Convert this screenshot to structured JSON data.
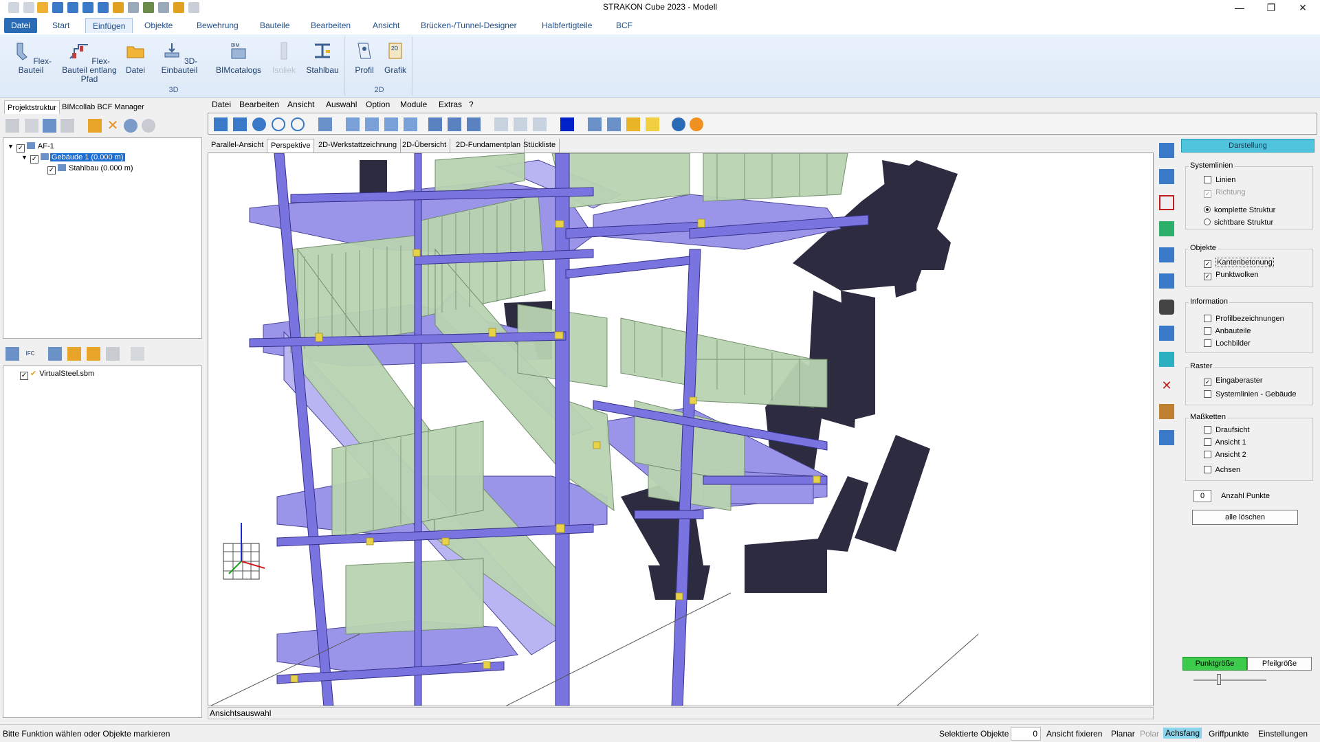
{
  "window": {
    "title": "STRAKON Cube 2023 - Modell",
    "controls": {
      "minimize": "—",
      "maximize": "❐",
      "close": "✕"
    }
  },
  "ribbon": {
    "tabs": [
      "Datei",
      "Start",
      "Einfügen",
      "Objekte",
      "Bewehrung",
      "Bauteile",
      "Bearbeiten",
      "Ansicht",
      "Brücken-/Tunnel-Designer",
      "Halbfertigteile",
      "BCF"
    ],
    "active_tab": "Einfügen",
    "groups": [
      {
        "label": "3D",
        "buttons": [
          {
            "label": "Flex-Bauteil",
            "icon": "flex-part-icon"
          },
          {
            "label": "Flex-Bauteil entlang Pfad",
            "icon": "flex-path-icon"
          },
          {
            "label": "Datei",
            "icon": "folder-icon"
          },
          {
            "label": "3D-Einbauteil",
            "icon": "insert-part-icon"
          },
          {
            "label": "BIMcatalogs",
            "icon": "bim-catalog-icon",
            "badge": "BIM"
          },
          {
            "label": "Isoliek",
            "icon": "isolation-icon",
            "disabled": true
          },
          {
            "label": "Stahlbau",
            "icon": "steel-icon"
          }
        ]
      },
      {
        "label": "2D",
        "buttons": [
          {
            "label": "Profil",
            "icon": "profile-icon"
          },
          {
            "label": "Grafik",
            "icon": "graphic-icon",
            "badge": "2D"
          }
        ]
      }
    ]
  },
  "left_panel": {
    "tabs": [
      "Projektstruktur",
      "BIMcollab BCF Manager"
    ],
    "active_tab": "Projektstruktur",
    "tree": [
      {
        "label": "AF-1",
        "checked": true,
        "level": 0
      },
      {
        "label": "Gebäude 1 (0.000 m)",
        "checked": true,
        "level": 1,
        "selected": true
      },
      {
        "label": "Stahlbau (0.000 m)",
        "checked": true,
        "level": 2
      }
    ],
    "lower_toolbar_badge": "IFC",
    "lower_tree": [
      {
        "label": "VirtualSteel.sbm",
        "checked": true
      }
    ]
  },
  "menu": [
    "Datei",
    "Bearbeiten",
    "Ansicht",
    "Auswahl",
    "Option",
    "Module",
    "Extras",
    "?"
  ],
  "view_tabs": [
    "Parallel-Ansicht",
    "Perspektive",
    "2D-Werkstattzeichnung",
    "2D-Übersicht",
    "2D-Fundamentplan",
    "Stückliste"
  ],
  "active_view_tab": "Perspektive",
  "view_status": "Ansichtsauswahl",
  "display_panel": {
    "header": "Darstellung",
    "groups": [
      {
        "title": "Systemlinien",
        "items": [
          {
            "type": "checkbox",
            "label": "Linien",
            "checked": false
          },
          {
            "type": "checkbox",
            "label": "Richtung",
            "checked": true,
            "disabled": true
          },
          {
            "type": "radio",
            "label": "komplette Struktur",
            "checked": true
          },
          {
            "type": "radio",
            "label": "sichtbare Struktur",
            "checked": false
          }
        ]
      },
      {
        "title": "Objekte",
        "items": [
          {
            "type": "checkbox",
            "label": "Kantenbetonung",
            "checked": true
          },
          {
            "type": "checkbox",
            "label": "Punktwolken",
            "checked": true
          }
        ]
      },
      {
        "title": "Information",
        "items": [
          {
            "type": "checkbox",
            "label": "Profilbezeichnungen",
            "checked": false
          },
          {
            "type": "checkbox",
            "label": "Anbauteile",
            "checked": false
          },
          {
            "type": "checkbox",
            "label": "Lochbilder",
            "checked": false
          }
        ]
      },
      {
        "title": "Raster",
        "items": [
          {
            "type": "checkbox",
            "label": "Eingaberaster",
            "checked": true
          },
          {
            "type": "checkbox",
            "label": "Systemlinien - Gebäude",
            "checked": false
          }
        ]
      },
      {
        "title": "Maßketten",
        "items": [
          {
            "type": "checkbox",
            "label": "Draufsicht",
            "checked": false
          },
          {
            "type": "checkbox",
            "label": "Ansicht 1",
            "checked": false
          },
          {
            "type": "checkbox",
            "label": "Ansicht 2",
            "checked": false
          },
          {
            "type": "checkbox",
            "label": "Achsen",
            "checked": false
          }
        ]
      }
    ],
    "anzahl_punkte_value": "0",
    "anzahl_punkte_label": "Anzahl Punkte",
    "clear_button": "alle löschen",
    "size_buttons": [
      "Punktgröße",
      "Pfeilgröße"
    ],
    "active_size_button": "Punktgröße",
    "accent_color": "#50c4dc"
  },
  "statusbar": {
    "message": "Bitte Funktion wählen oder Objekte markieren",
    "selected_label": "Selektierte Objekte",
    "selected_count": "0",
    "items": [
      "Ansicht fixieren",
      "Planar",
      "Polar",
      "Achsfang",
      "Griffpunkte",
      "Einstellungen"
    ],
    "highlighted": "Achsfang",
    "dimmed": "Polar"
  },
  "colors": {
    "steel": "#8a84e6",
    "railing": "#a9c7a0",
    "concrete": "#2c2b40",
    "plates": "#e8d24a"
  }
}
